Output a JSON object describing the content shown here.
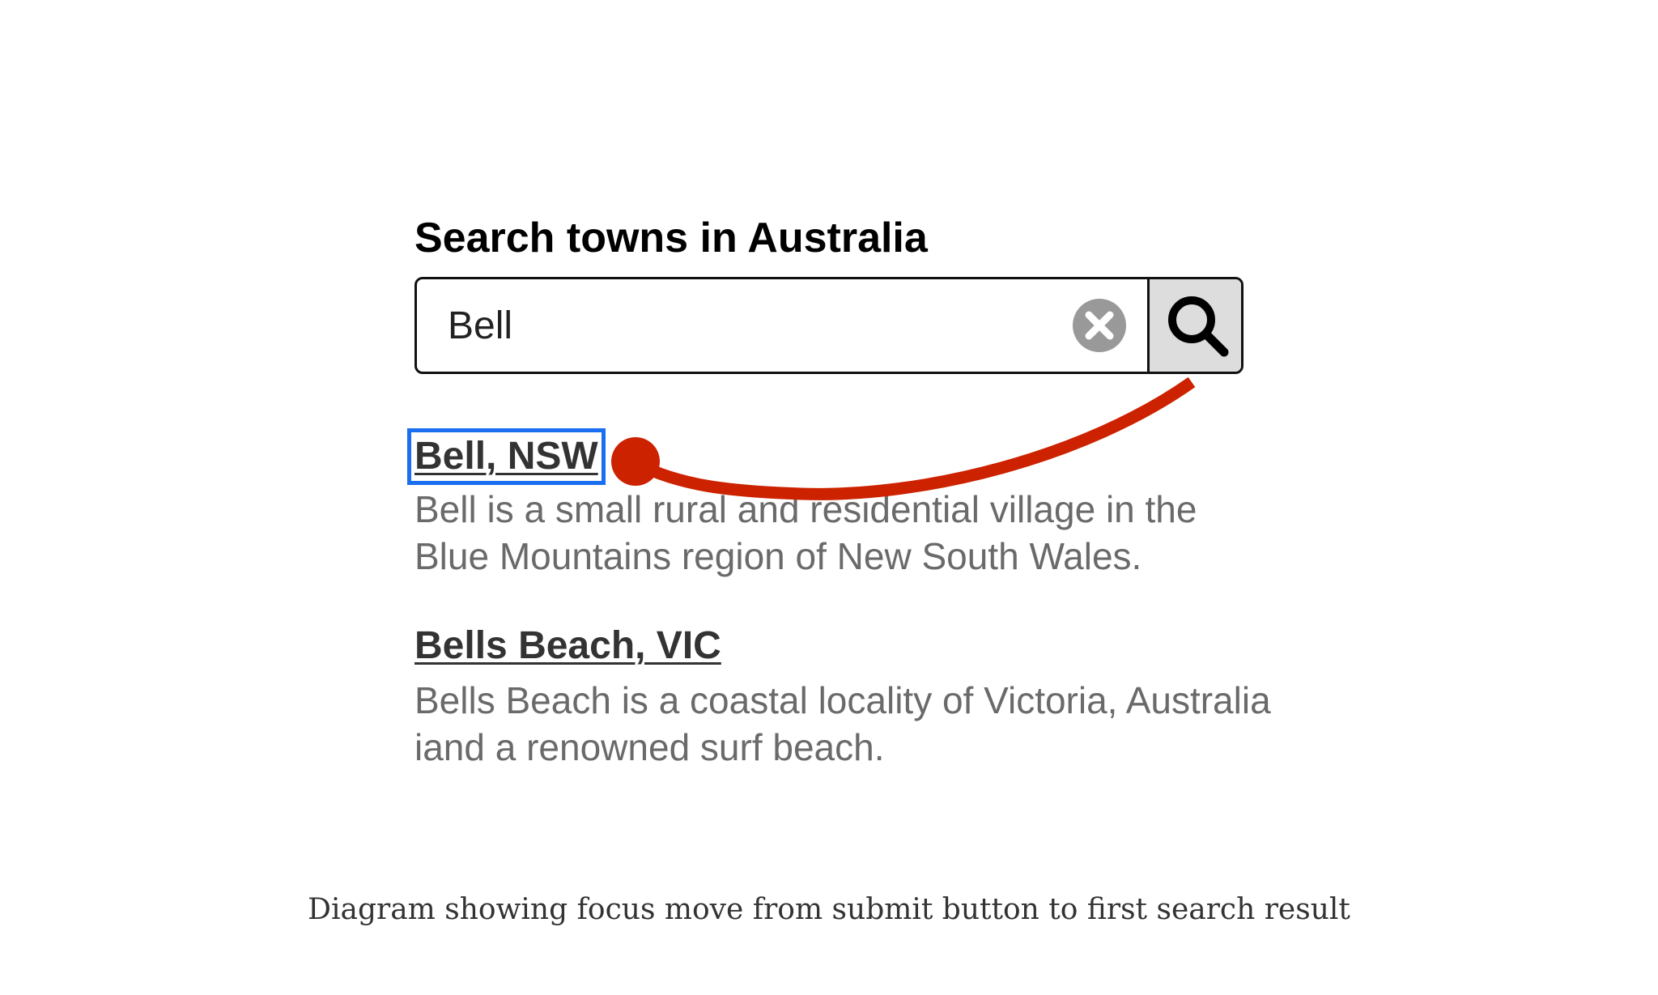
{
  "search": {
    "heading": "Search towns in Australia",
    "value": "Bell",
    "clear_icon": "clear-circle-x-icon",
    "submit_icon": "magnifier-icon"
  },
  "results": [
    {
      "title": "Bell, NSW",
      "description": "Bell is a small rural and residential village in the Blue Mountains region of New South Wales.",
      "focused": true
    },
    {
      "title": "Bells Beach, VIC",
      "description": "Bells Beach is a coastal locality of Victoria, Australia iand a renowned surf beach.",
      "focused": false
    }
  ],
  "caption": "Diagram showing focus move from submit button to first search result",
  "colors": {
    "focus_outline": "#1a6ff0",
    "arrow": "#cc2200",
    "button_background": "#dddddd",
    "clear_icon": "#999999"
  }
}
